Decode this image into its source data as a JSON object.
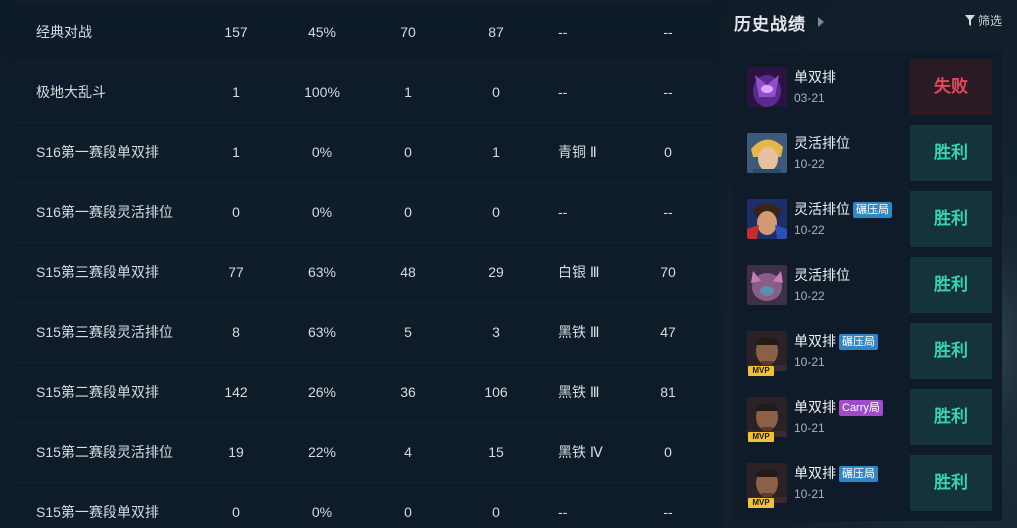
{
  "stats_table": {
    "rows": [
      {
        "mode": "经典对战",
        "total": "157",
        "win_rate": "45%",
        "wins": "70",
        "losses": "87",
        "rank": "--",
        "lp": "--"
      },
      {
        "mode": "极地大乱斗",
        "total": "1",
        "win_rate": "100%",
        "wins": "1",
        "losses": "0",
        "rank": "--",
        "lp": "--"
      },
      {
        "mode": "S16第一赛段单双排",
        "total": "1",
        "win_rate": "0%",
        "wins": "0",
        "losses": "1",
        "rank": "青铜 Ⅱ",
        "lp": "0"
      },
      {
        "mode": "S16第一赛段灵活排位",
        "total": "0",
        "win_rate": "0%",
        "wins": "0",
        "losses": "0",
        "rank": "--",
        "lp": "--"
      },
      {
        "mode": "S15第三赛段单双排",
        "total": "77",
        "win_rate": "63%",
        "wins": "48",
        "losses": "29",
        "rank": "白银 Ⅲ",
        "lp": "70"
      },
      {
        "mode": "S15第三赛段灵活排位",
        "total": "8",
        "win_rate": "63%",
        "wins": "5",
        "losses": "3",
        "rank": "黑铁 Ⅲ",
        "lp": "47"
      },
      {
        "mode": "S15第二赛段单双排",
        "total": "142",
        "win_rate": "26%",
        "wins": "36",
        "losses": "106",
        "rank": "黑铁 Ⅲ",
        "lp": "81"
      },
      {
        "mode": "S15第二赛段灵活排位",
        "total": "19",
        "win_rate": "22%",
        "wins": "4",
        "losses": "15",
        "rank": "黑铁 Ⅳ",
        "lp": "0"
      },
      {
        "mode": "S15第一赛段单双排",
        "total": "0",
        "win_rate": "0%",
        "wins": "0",
        "losses": "0",
        "rank": "--",
        "lp": "--"
      }
    ]
  },
  "history": {
    "title": "历史战绩",
    "filter_label": "筛选",
    "matches": [
      {
        "mode": "单双排",
        "date": "03-21",
        "badge": "",
        "result": "失败",
        "outcome": "lose",
        "mvp": false,
        "champion_icon": "purple-assassin-portrait"
      },
      {
        "mode": "灵活排位",
        "date": "10-22",
        "badge": "",
        "result": "胜利",
        "outcome": "win",
        "mvp": false,
        "champion_icon": "blonde-hero-portrait"
      },
      {
        "mode": "灵活排位",
        "date": "10-22",
        "badge": "碾压局",
        "result": "胜利",
        "outcome": "win",
        "mvp": false,
        "champion_icon": "red-blue-fighter-portrait"
      },
      {
        "mode": "灵活排位",
        "date": "10-22",
        "badge": "",
        "result": "胜利",
        "outcome": "win",
        "mvp": false,
        "champion_icon": "pink-creature-portrait"
      },
      {
        "mode": "单双排",
        "date": "10-21",
        "badge": "碾压局",
        "result": "胜利",
        "outcome": "win",
        "mvp": true,
        "champion_icon": "dark-warrior-portrait"
      },
      {
        "mode": "单双排",
        "date": "10-21",
        "badge": "Carry局",
        "result": "胜利",
        "outcome": "win",
        "mvp": true,
        "champion_icon": "dark-warrior-portrait"
      },
      {
        "mode": "单双排",
        "date": "10-21",
        "badge": "碾压局",
        "result": "胜利",
        "outcome": "win",
        "mvp": true,
        "champion_icon": "dark-warrior-portrait"
      }
    ],
    "mvp_label": "MVP"
  }
}
